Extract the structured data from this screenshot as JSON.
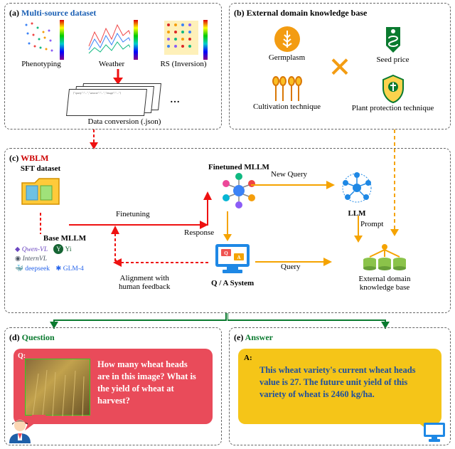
{
  "panelA": {
    "title": "Multi-source dataset",
    "charts": {
      "c1": "Phenotyping",
      "c2": "Weather",
      "c3": "RS (Inversion)"
    },
    "conversion": "Data conversion (.json)"
  },
  "panelB": {
    "title": "External domain knowledge base",
    "items": {
      "germplasm": "Germplasm",
      "seed_price": "Seed price",
      "cultivation": "Cultivation technique",
      "plant_protection": "Plant protection technique"
    }
  },
  "panelC": {
    "title": "WBLM",
    "sft": "SFT dataset",
    "base_mllm": "Base MLLM",
    "finetuning": "Finetuning",
    "finetuned": "Finetuned MLLM",
    "new_query": "New Query",
    "llm": "LLM",
    "response": "Response",
    "prompt": "Prompt",
    "qa_system": "Q / A System",
    "query": "Query",
    "alignment": "Alignment with\nhuman feedback",
    "ext_kb": "External domain\nknowledge base",
    "base_models": {
      "qwen": "Qwen-VL",
      "yi": "Yi",
      "intern": "InternVL",
      "deepseek": "deepseek",
      "glm": "GLM-4"
    }
  },
  "panelD": {
    "title": "Question",
    "q_label": "Q:",
    "text": "How many wheat heads are in this image? What is the yield of wheat at harvest?"
  },
  "panelE": {
    "title": "Answer",
    "a_label": "A:",
    "text": "This wheat variety's current wheat heads value is 27. The future unit yield of this variety of wheat is 2460 kg/ha."
  }
}
